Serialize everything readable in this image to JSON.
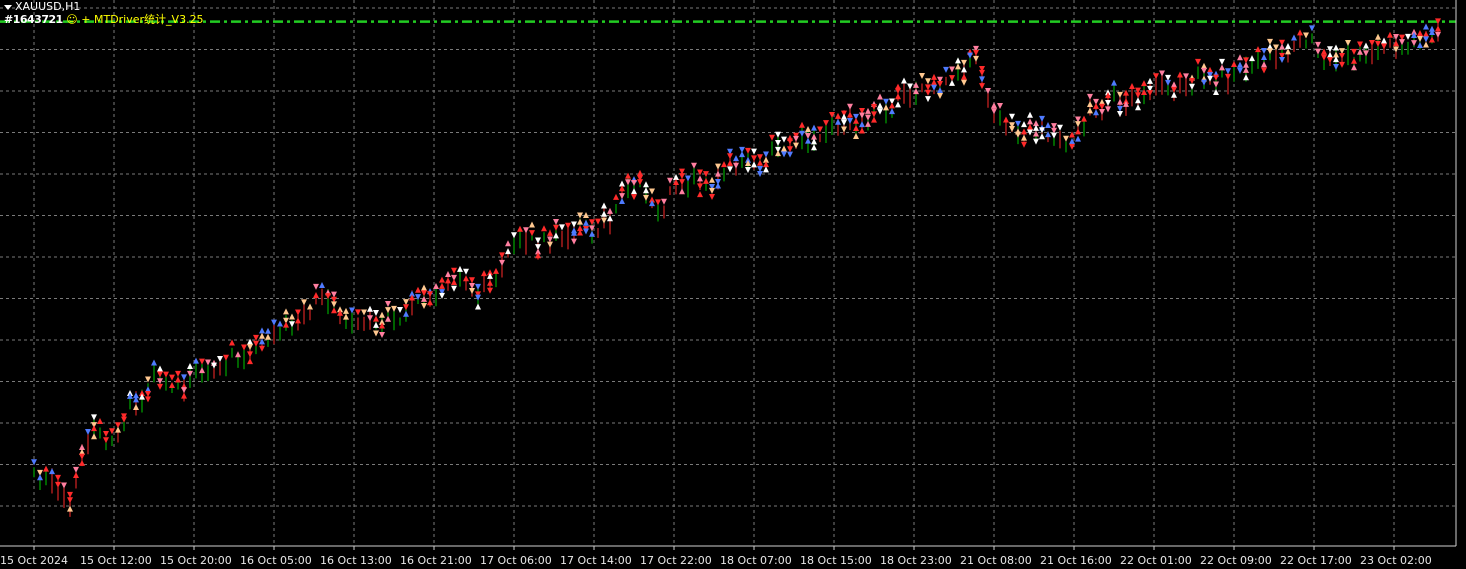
{
  "header": {
    "symbol_title": "XAUUSD,H1",
    "account_text": "#1643721",
    "smile_glyph": "☺",
    "plus_glyph": "+",
    "ea_name": "MTDriver统计_V3.25"
  },
  "colors": {
    "background": "#000000",
    "grid": "#7a7a7a",
    "bull_marker": "#ff2a2a",
    "bear_marker": "#4f7bff",
    "neutral_marker": "#ffffff",
    "peach_marker": "#ffc890",
    "bull_candle": "#00c800",
    "bear_candle": "#ff2a2a",
    "level_line": "#22cc22"
  },
  "chart_data": {
    "type": "line",
    "title": "XAUUSD,H1",
    "xlabel": "",
    "ylabel": "",
    "grid": true,
    "x_tick_labels": [
      "15 Oct 2024",
      "15 Oct 12:00",
      "15 Oct 20:00",
      "16 Oct 05:00",
      "16 Oct 13:00",
      "16 Oct 21:00",
      "17 Oct 06:00",
      "17 Oct 14:00",
      "17 Oct 22:00",
      "18 Oct 07:00",
      "18 Oct 15:00",
      "18 Oct 23:00",
      "21 Oct 08:00",
      "21 Oct 16:00",
      "22 Oct 01:00",
      "22 Oct 09:00",
      "22 Oct 17:00",
      "23 Oct 02:00"
    ],
    "x_range": [
      0,
      17.85
    ],
    "y_range": [
      0,
      1
    ],
    "series": [
      {
        "x": [
          0,
          0.3,
          0.45,
          0.7,
          1,
          1.2,
          1.5,
          1.8,
          2,
          2.3,
          2.5,
          2.8,
          3,
          3.3,
          3.5,
          3.7,
          4,
          4.2,
          4.5,
          4.7,
          5,
          5.3,
          5.6,
          5.8,
          6,
          6.3,
          6.5,
          6.8,
          7,
          7.2,
          7.4,
          7.6,
          7.8,
          8,
          8.3,
          8.5,
          8.7,
          9,
          9.2,
          9.5,
          9.8,
          10,
          10.3,
          10.6,
          10.9,
          11.2,
          11.5,
          11.8,
          12,
          12.3,
          12.6,
          12.8,
          13,
          13.2,
          13.5,
          13.8,
          14,
          14.3,
          14.6,
          14.9,
          15.2,
          15.5,
          15.8,
          16,
          16.2,
          16.5,
          16.8,
          17,
          17.2,
          17.4,
          17.6
        ],
        "y": [
          0.06,
          0.02,
          -0.01,
          0.15,
          0.12,
          0.2,
          0.26,
          0.24,
          0.28,
          0.27,
          0.31,
          0.33,
          0.35,
          0.39,
          0.42,
          0.44,
          0.37,
          0.38,
          0.39,
          0.41,
          0.45,
          0.47,
          0.45,
          0.5,
          0.57,
          0.56,
          0.57,
          0.59,
          0.59,
          0.61,
          0.67,
          0.7,
          0.62,
          0.67,
          0.7,
          0.67,
          0.73,
          0.73,
          0.75,
          0.77,
          0.79,
          0.82,
          0.82,
          0.85,
          0.88,
          0.89,
          0.92,
          0.95,
          0.84,
          0.79,
          0.81,
          0.77,
          0.79,
          0.84,
          0.87,
          0.88,
          0.9,
          0.9,
          0.92,
          0.92,
          0.94,
          0.97,
          0.99,
          0.99,
          0.95,
          0.96,
          0.99,
          0.98,
          0.98,
          1.0,
          1.03
        ]
      }
    ],
    "levels": [
      {
        "label": "",
        "y": 1.04,
        "style": "dash-dot"
      }
    ]
  }
}
